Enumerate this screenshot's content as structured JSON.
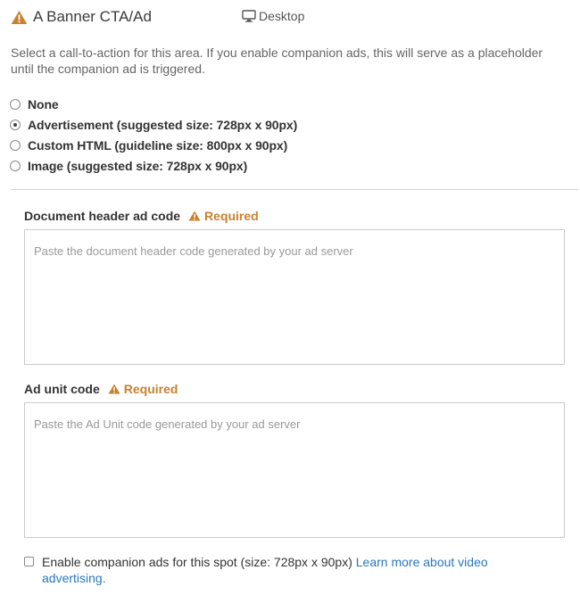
{
  "header": {
    "title": "A Banner CTA/Ad",
    "device_label": "Desktop"
  },
  "description": "Select a call-to-action for this area. If you enable companion ads, this will serve as a placeholder until the companion ad is triggered.",
  "options": [
    {
      "label": "None",
      "checked": false
    },
    {
      "label": "Advertisement (suggested size: 728px x 90px)",
      "checked": true
    },
    {
      "label": "Custom HTML (guideline size: 800px x 90px)",
      "checked": false
    },
    {
      "label": "Image (suggested size: 728px x 90px)",
      "checked": false
    }
  ],
  "fields": {
    "doc_header": {
      "label": "Document header ad code",
      "required": "Required",
      "placeholder": "Paste the document header code generated by your ad server"
    },
    "ad_unit": {
      "label": "Ad unit code",
      "required": "Required",
      "placeholder": "Paste the Ad Unit code generated by your ad server"
    }
  },
  "companion": {
    "label": "Enable companion ads for this spot (size: 728px x 90px)",
    "link": "Learn more about video advertising.",
    "checked": false
  },
  "colors": {
    "warning": "#c8822f",
    "link": "#2a77c0"
  }
}
